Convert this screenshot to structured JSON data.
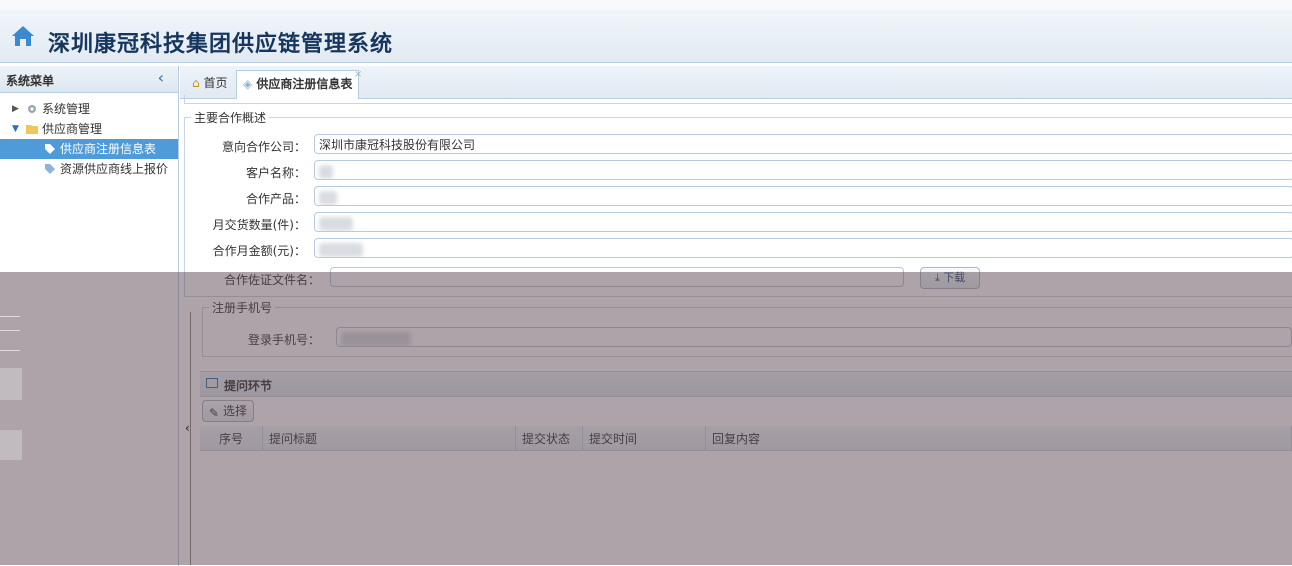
{
  "header": {
    "title": "深圳康冠科技集团供应链管理系统",
    "home_icon": "home-icon"
  },
  "sidebar": {
    "title": "系统菜单",
    "items": [
      {
        "label": "系统管理",
        "level": 1,
        "expanded": false,
        "icon": "gear-icon"
      },
      {
        "label": "供应商管理",
        "level": 1,
        "expanded": true,
        "icon": "folder-icon"
      },
      {
        "label": "供应商注册信息表",
        "level": 2,
        "selected": true,
        "icon": "tag-icon"
      },
      {
        "label": "资源供应商线上报价",
        "level": 2,
        "selected": false,
        "icon": "tag-icon"
      }
    ]
  },
  "tabs": [
    {
      "label": "首页",
      "icon": "home-icon",
      "active": false
    },
    {
      "label": "供应商注册信息表",
      "icon": "tag-icon",
      "active": true,
      "close": "×"
    }
  ],
  "cooperation": {
    "legend": "主要合作概述",
    "fields": [
      {
        "label": "意向合作公司：",
        "value": "深圳市康冠科技股份有限公司"
      },
      {
        "label": "客户名称：",
        "value": ""
      },
      {
        "label": "合作产品：",
        "value": ""
      },
      {
        "label": "月交货数量(件)：",
        "value": ""
      },
      {
        "label": "合作月金额(元)：",
        "value": ""
      }
    ],
    "file_label": "合作佐证文件名：",
    "download_label": "下载"
  },
  "register": {
    "legend": "注册手机号",
    "phone_label": "登录手机号：",
    "phone_value": ""
  },
  "questions": {
    "title": "提问环节",
    "select_label": "选择",
    "columns": [
      "序号",
      "提问标题",
      "提交状态",
      "提交时间",
      "回复内容"
    ]
  },
  "colors": {
    "accent": "#4f9ad9",
    "title": "#17365d",
    "border": "#b8cde0"
  }
}
